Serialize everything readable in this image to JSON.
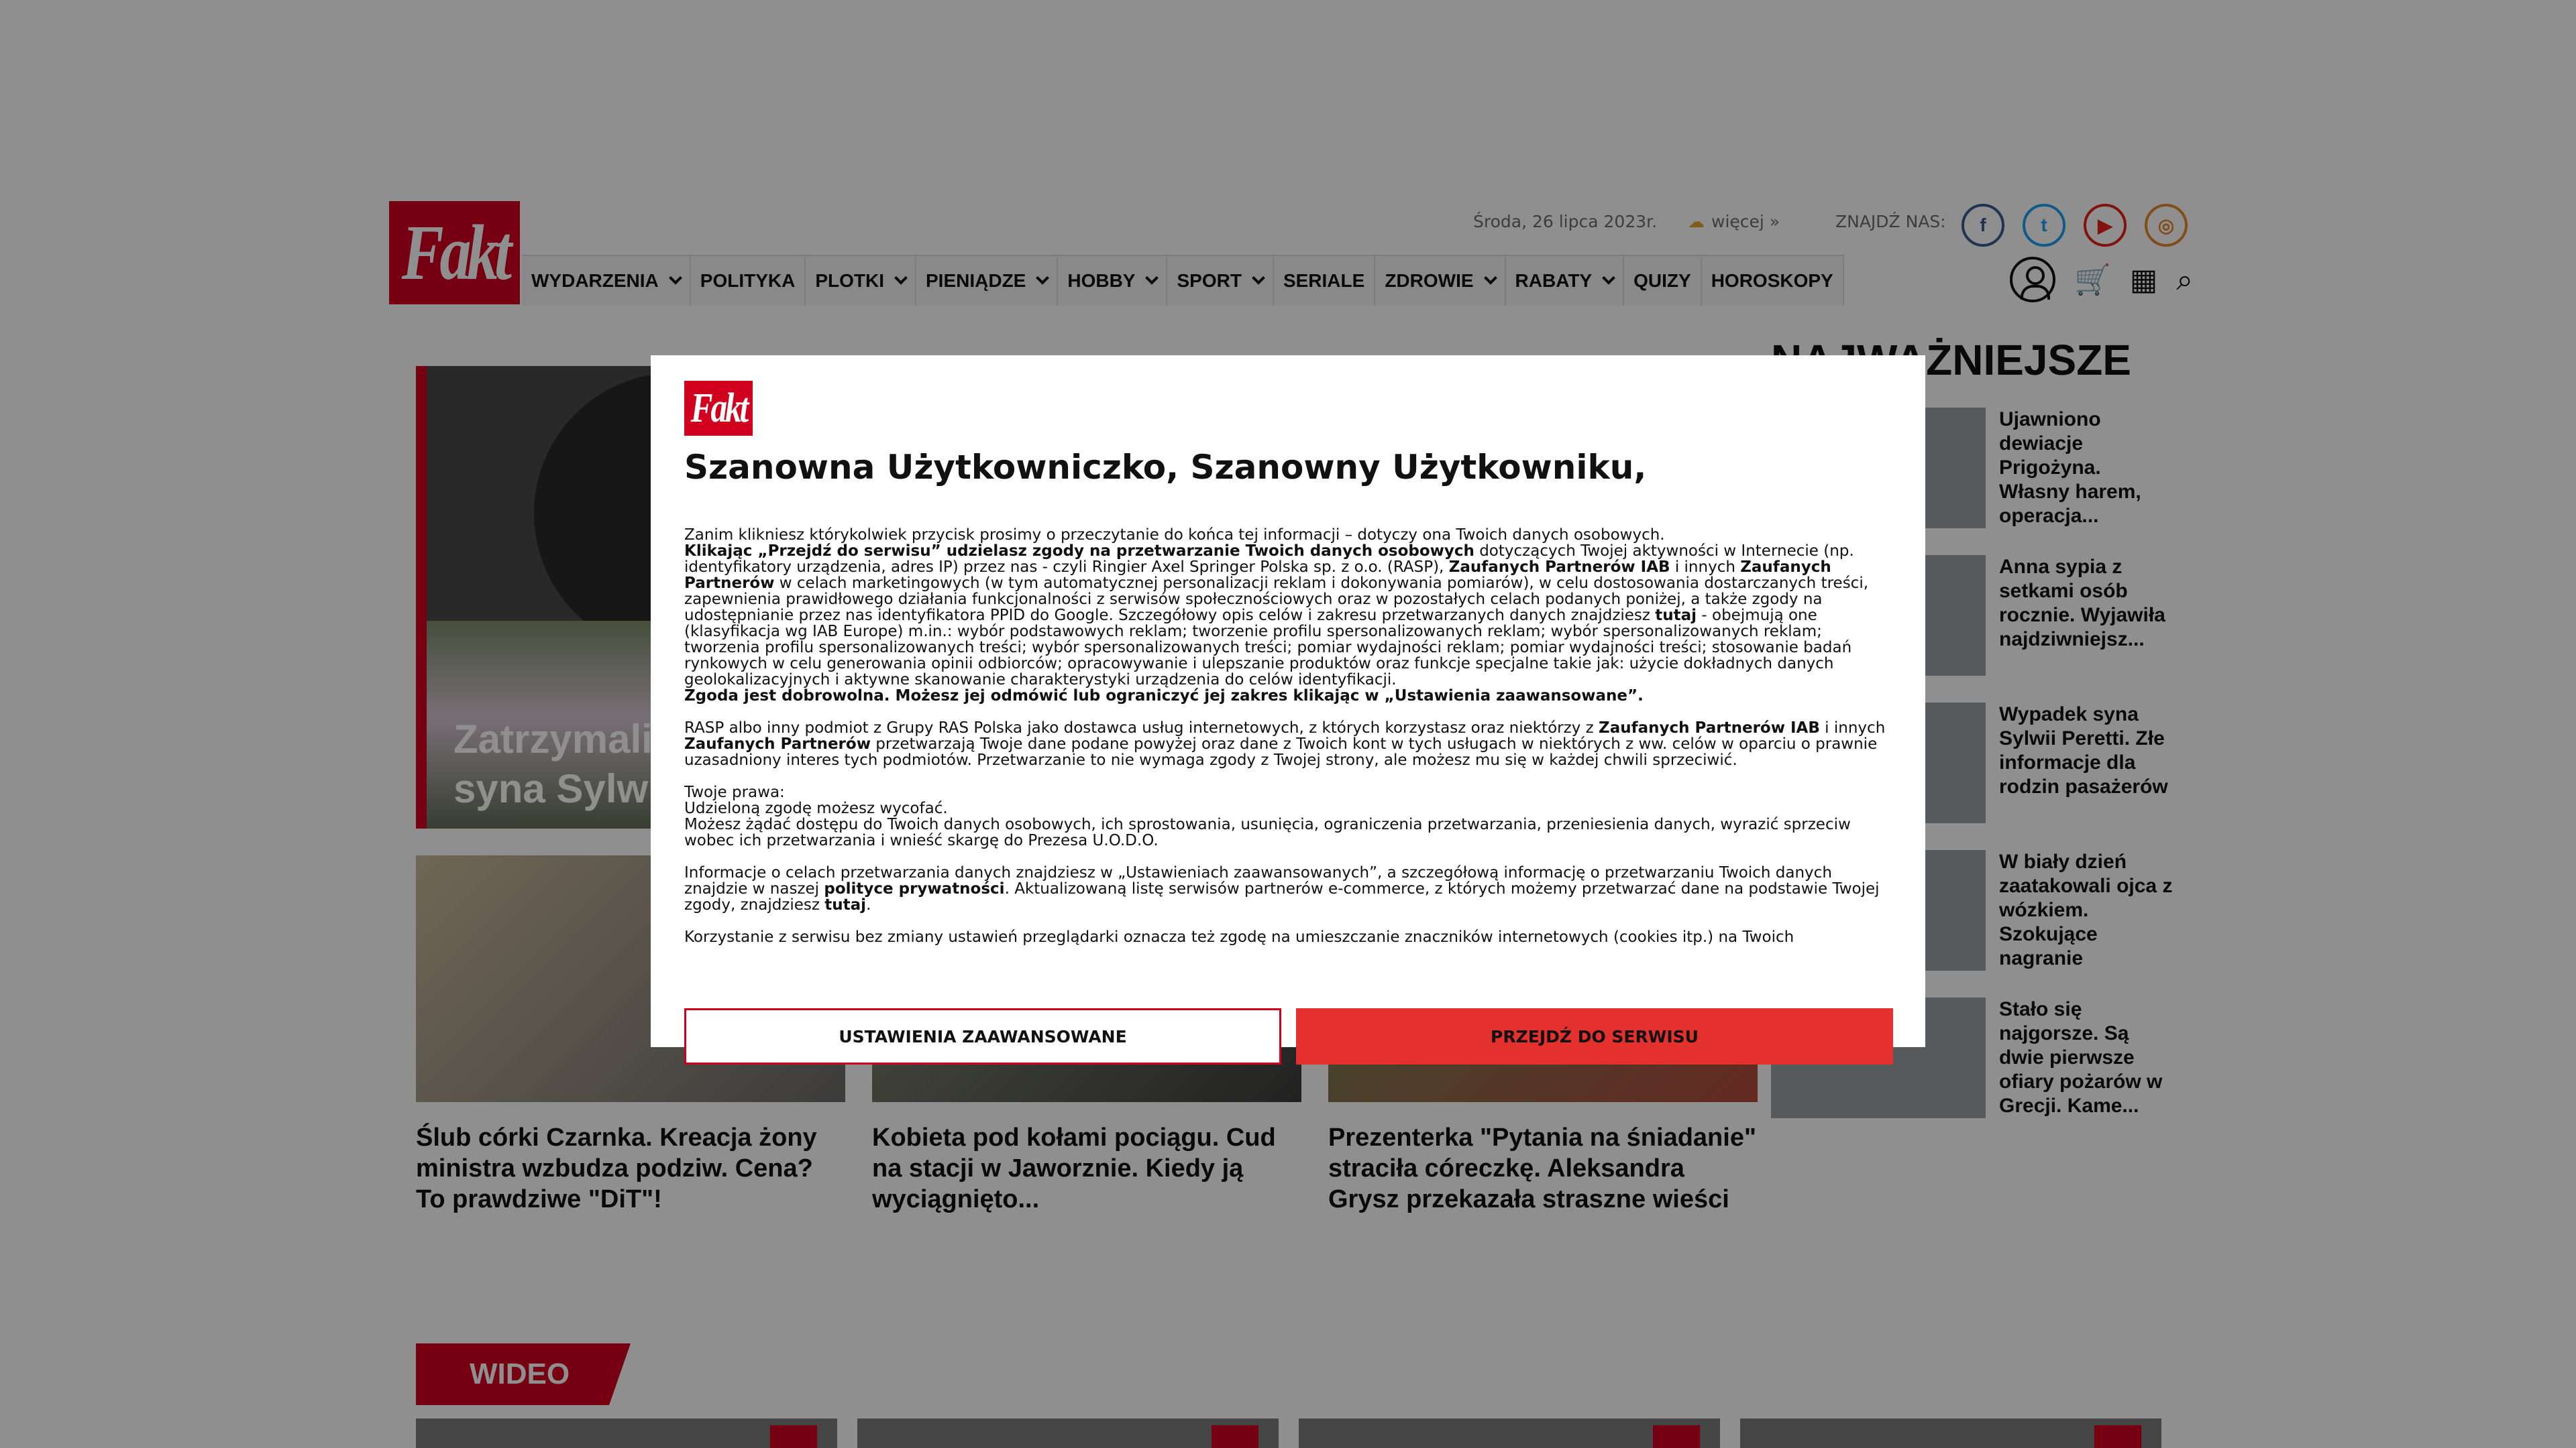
{
  "site": {
    "logo_text": "Fakt"
  },
  "topbar": {
    "date": "Środa, 26 lipca 2023r.",
    "weather_more": "więcej »",
    "find_us": "ZNAJDŹ NAS:",
    "social": [
      "facebook-icon",
      "twitter-icon",
      "youtube-icon",
      "instagram-icon"
    ]
  },
  "nav": {
    "items": [
      {
        "label": "WYDARZENIA",
        "has_menu": true
      },
      {
        "label": "POLITYKA",
        "has_menu": false
      },
      {
        "label": "PLOTKI",
        "has_menu": true
      },
      {
        "label": "PIENIĄDZE",
        "has_menu": true
      },
      {
        "label": "HOBBY",
        "has_menu": true
      },
      {
        "label": "SPORT",
        "has_menu": true
      },
      {
        "label": "SERIALE",
        "has_menu": false
      },
      {
        "label": "ZDROWIE",
        "has_menu": true
      },
      {
        "label": "RABATY",
        "has_menu": true
      },
      {
        "label": "QUIZY",
        "has_menu": false
      },
      {
        "label": "HOROSKOPY",
        "has_menu": false
      }
    ]
  },
  "main": {
    "lead_title_1": "Zatrzymali",
    "lead_title_2": "syna Sylwi",
    "tiles": [
      {
        "caption": "Ślub córki Czarnka. Kreacja żony ministra wzbudza podziw. Cena? To prawdziwe \"DiT\"!"
      },
      {
        "caption": "Kobieta pod kołami pociągu. Cud na stacji w Jaworznie. Kiedy ją wyciągnięto..."
      },
      {
        "caption": "Prezenterka \"Pytania na śniadanie\" straciła córeczkę. Aleksandra Grysz przekazała straszne wieści"
      }
    ]
  },
  "sidebar": {
    "title": "NAJWAŻNIEJSZE",
    "items": [
      "Ujawniono dewiacje Prigożyna. Własny harem, operacja...",
      "Anna sypia z setkami osób rocznie. Wyjawiła najdziwniejsz...",
      "Wypadek syna Sylwii Peretti. Złe informacje dla rodzin pasażerów",
      "W biały dzień zaatakowali ojca z wózkiem. Szokujące nagranie",
      "Stało się najgorsze. Są dwie pierwsze ofiary pożarów w Grecji. Kame..."
    ]
  },
  "video": {
    "label": "WIDEO"
  },
  "consent": {
    "logo_text": "Fakt",
    "title": "Szanowna Użytkowniczko, Szanowny Użytkowniku,",
    "p1_intro": "Zanim klikniesz którykolwiek przycisk prosimy o przeczytanie do końca tej informacji – dotyczy ona Twoich danych osobowych.",
    "p1_b1": "Klikając „Przejdź do serwisu” udzielasz zgody na przetwarzanie Twoich danych osobowych",
    "p1_t1": " dotyczących Twojej aktywności w Internecie (np. identyfikatory urządzenia, adres IP) przez nas - czyli Ringier Axel Springer Polska sp. z o.o. (RASP), ",
    "p1_b2": "Zaufanych Partnerów IAB",
    "p1_t2": " i innych ",
    "p1_b3": "Zaufanych Partnerów",
    "p1_t3": " w celach marketingowych (w tym automatycznej personalizacji reklam i dokonywania pomiarów), w celu dostosowania dostarczanych treści, zapewnienia prawidłowego działania funkcjonalności z serwisów społecznościowych oraz w pozostałych celach podanych poniżej, a także zgody na udostępnianie przez nas identyfikatora PPID do Google. Szczegółowy opis celów i zakresu przetwarzanych danych znajdziesz ",
    "p1_b4": "tutaj",
    "p1_t4": " - obejmują one (klasyfikacja wg IAB Europe) m.in.: wybór podstawowych reklam; tworzenie profilu spersonalizowanych reklam; wybór spersonalizowanych reklam; tworzenia profilu spersonalizowanych treści; wybór spersonalizowanych treści; pomiar wydajności reklam; pomiar wydajności treści; stosowanie badań rynkowych w celu generowania opinii odbiorców; opracowywanie i ulepszanie produktów oraz funkcje specjalne takie jak: użycie dokładnych danych geolokalizacyjnych i aktywne skanowanie charakterystyki urządzenia do celów identyfikacji.",
    "p1_b5": "Zgoda jest dobrowolna. Możesz jej odmówić lub ograniczyć jej zakres klikając w „Ustawienia zaawansowane”.",
    "p2_t1": "RASP albo inny podmiot z Grupy RAS Polska jako dostawca usług internetowych, z których korzystasz oraz niektórzy z ",
    "p2_b1": "Zaufanych Partnerów IAB",
    "p2_t2": " i innych ",
    "p2_b2": "Zaufanych Partnerów",
    "p2_t3": " przetwarzają Twoje dane podane powyżej oraz dane z Twoich kont w tych usługach w niektórych z ww. celów w oparciu o prawnie uzasadniony interes tych podmiotów. Przetwarzanie to nie wymaga zgody z Twojej strony, ale możesz mu się w każdej chwili sprzeciwić.",
    "p3_l1": "Twoje prawa:",
    "p3_l2": "Udzieloną zgodę możesz wycofać.",
    "p3_l3": "Możesz żądać dostępu do Twoich danych osobowych, ich sprostowania, usunięcia, ograniczenia przetwarzania, przeniesienia danych, wyrazić sprzeciw wobec ich przetwarzania i wnieść skargę do Prezesa U.O.D.O.",
    "p4_t1": "Informacje o celach przetwarzania danych znajdziesz w „Ustawieniach zaawansowanych”, a szczegółową informację o przetwarzaniu Twoich danych znajdzie w naszej ",
    "p4_b1": "polityce prywatności",
    "p4_t2": ". Aktualizowaną listę serwisów partnerów e-commerce, z których możemy przetwarzać dane na podstawie Twojej zgody, znajdziesz ",
    "p4_b2": "tutaj",
    "p4_t3": ".",
    "p5": "Korzystanie z serwisu bez zmiany ustawień przeglądarki oznacza też zgodę na umieszczanie znaczników internetowych (cookies itp.) na Twoich",
    "btn_advanced": "USTAWIENIA ZAAWANSOWANE",
    "btn_accept": "PRZEJDŹ DO SERWISU"
  }
}
